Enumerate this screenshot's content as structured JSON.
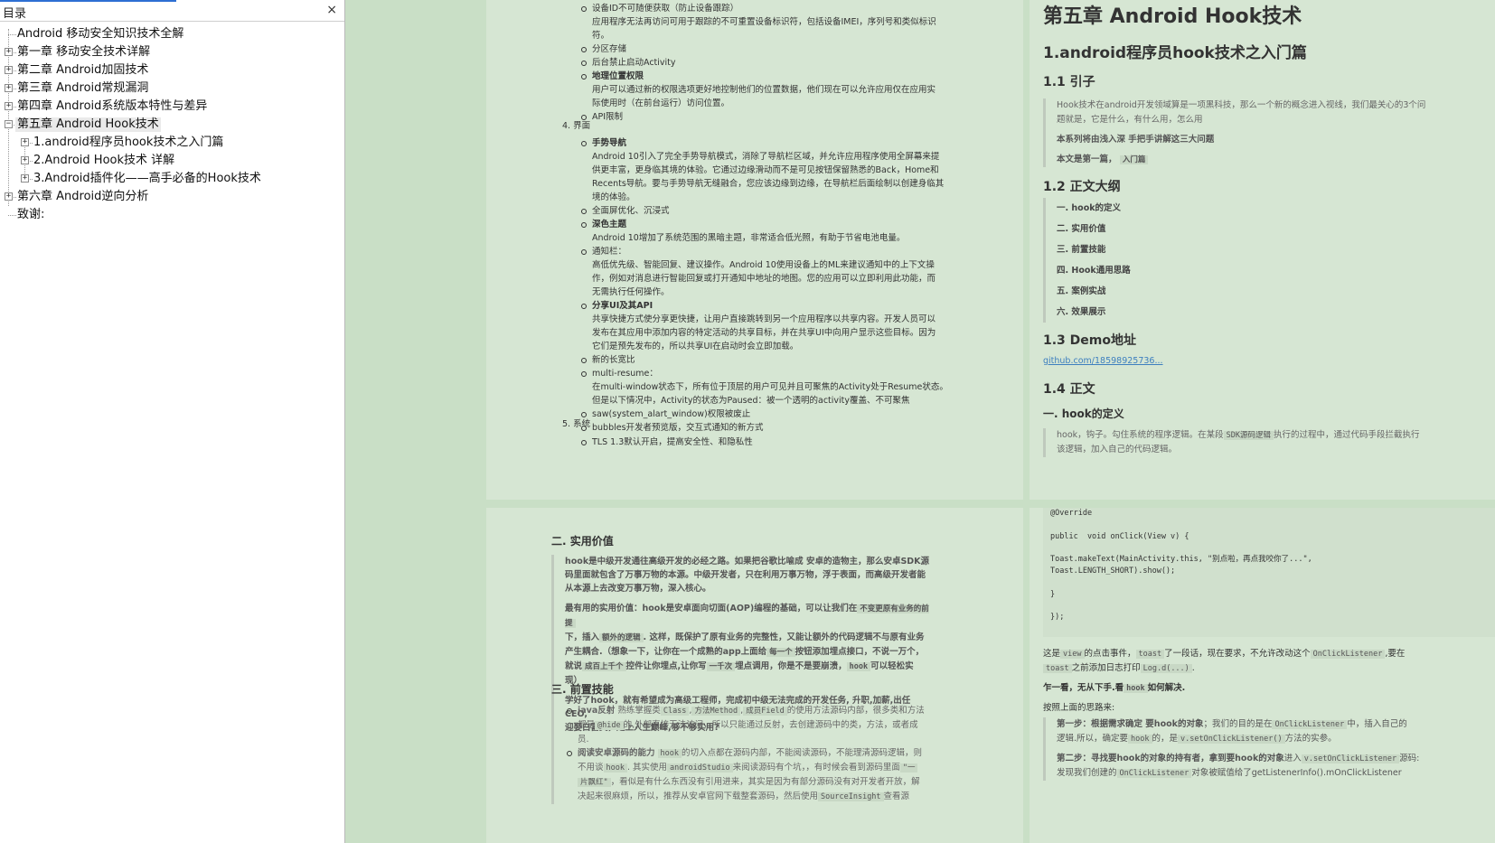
{
  "toc": {
    "title": "目录",
    "close_icon": "×",
    "items": [
      {
        "label": "Android 移动安全知识技术全解"
      },
      {
        "label": "第一章 移动安全技术详解"
      },
      {
        "label": "第二章 Android加固技术"
      },
      {
        "label": "第三章 Android常规漏洞"
      },
      {
        "label": "第四章 Android系统版本特性与差异"
      },
      {
        "label": "第五章 Android Hook技术"
      },
      {
        "label": "1.android程序员hook技术之入门篇"
      },
      {
        "label": "2.Android Hook技术 详解"
      },
      {
        "label": "3.Android插件化——高手必备的Hook技术"
      },
      {
        "label": "第六章 Android逆向分析"
      },
      {
        "label": "致谢:"
      }
    ],
    "expander_plus": "+",
    "expander_minus": "−"
  },
  "page_tl": {
    "items": [
      {
        "title": "设备ID不可随便获取（防止设备跟踪）",
        "bold": false,
        "desc": [
          "应用程序无法再访问可用于跟踪的不可重置设备标识符，包括设备IMEI，序列号和类似标识",
          "符。"
        ]
      },
      {
        "title": "分区存储",
        "bold": false,
        "desc": []
      },
      {
        "title": "后台禁止启动Activity",
        "bold": false,
        "desc": []
      },
      {
        "title": "地理位置权限",
        "bold": true,
        "desc": [
          "用户可以通过新的权限选项更好地控制他们的位置数据，他们现在可以允许应用仅在应用实",
          "际使用时（在前台运行）访问位置。"
        ]
      },
      {
        "title": "API限制",
        "bold": false,
        "desc": []
      }
    ],
    "section4": "4. 界面",
    "section4_items": [
      {
        "title": "手势导航",
        "bold": true,
        "desc": [
          "Android 10引入了完全手势导航模式，消除了导航栏区域，并允许应用程序使用全屏幕来提",
          "供更丰富，更身临其境的体验。它通过边缘滑动而不是可见按钮保留熟悉的Back，Home和",
          "Recents导航。要与手势导航无缝融合，您应该边缘到边缘，在导航栏后面绘制以创建身临其",
          "境的体验。"
        ]
      },
      {
        "title": "全面屏优化、沉浸式",
        "bold": false,
        "desc": []
      },
      {
        "title": "深色主题",
        "bold": true,
        "desc": [
          "Android 10增加了系统范围的黑暗主题，非常适合低光照，有助于节省电池电量。"
        ]
      },
      {
        "title": "通知栏：",
        "bold": false,
        "desc": [
          "高低优先级、智能回复、建议操作。Android 10使用设备上的ML来建议通知中的上下文操",
          "作，例如对消息进行智能回复或打开通知中地址的地图。您的应用可以立即利用此功能，而",
          "无需执行任何操作。"
        ]
      },
      {
        "title": "分享UI及其API",
        "bold": true,
        "desc": [
          "共享快捷方式使分享更快捷，让用户直接跳转到另一个应用程序以共享内容。开发人员可以",
          "发布在其应用中添加内容的特定活动的共享目标，并在共享UI中向用户显示这些目标。因为",
          "它们是预先发布的，所以共享UI在启动时会立即加载。"
        ]
      },
      {
        "title": "新的长宽比",
        "bold": false,
        "desc": []
      },
      {
        "title": "multi-resume：",
        "bold": false,
        "desc": [
          "在multi-window状态下，所有位于顶层的用户可见并且可聚焦的Activity处于Resume状态。",
          "但是以下情况中，Activity的状态为Paused：被一个透明的activity覆盖、不可聚焦"
        ]
      },
      {
        "title": "saw(system_alart_window)权限被废止",
        "bold": false,
        "desc": []
      },
      {
        "title": "bubbles开发者预览版，交互式通知的新方式",
        "bold": false,
        "desc": []
      }
    ],
    "section5": "5. 系统",
    "section5_items": [
      {
        "title": "TLS 1.3默认开启，提高安全性、和隐私性",
        "bold": false,
        "desc": []
      }
    ]
  },
  "page_tr": {
    "h1": "第五章 Android Hook技术",
    "h2": "1.android程序员hook技术之入门篇",
    "s11": "1.1 引子",
    "quote_lines": [
      "Hook技术在android开发领域算是一项黑科技，那么一个新的概念进入视线，我们最关心的3个问",
      "题就是，它是什么，有什么用，怎么用"
    ],
    "series_note": "本系列将由浅入深 手把手讲解这三大问题",
    "article_note": "本文是第一篇，",
    "article_tag": "入门篇",
    "s12": "1.2 正文大纲",
    "outline": [
      "一. hook的定义",
      "二. 实用价值",
      "三. 前置技能",
      "四. Hook通用思路",
      "五. 案例实战",
      "六. 效果展示"
    ],
    "s13": "1.3 Demo地址",
    "demo_link": "github.com/18598925736...",
    "s14": "1.4 正文",
    "s_def": "一. hook的定义",
    "def_part1": "hook，钩子。勾住系统的程序逻辑。在某段",
    "def_code": "SDK源码逻辑",
    "def_part2": "执行的过程中，通过代码手段拦截执行",
    "def_line2": "该逻辑，加入自己的代码逻辑。"
  },
  "page_bl": {
    "h_value": "二. 实用价值",
    "p1_lines": [
      "hook是中级开发通往高级开发的必经之路。如果把谷歌比喻成 安卓的造物主，那么安卓SDK源",
      "码里面就包含了万事万物的本源。中级开发者，只在利用万事万物，浮于表面，而高级开发者能",
      "从本源上去改变万事万物，深入核心。"
    ],
    "p2_a": "最有用的实用价值：hook是安卓面向切面(AOP)编程的基础，可以让我们在",
    "p2_code1": "不变更原有业务的前提",
    "p2_b": "下，插入",
    "p2_code2": "额外的逻辑",
    "p2_c": ". 这样，既保护了原有业务的完整性，又能让额外的代码逻辑不与原有业务",
    "p2_line3": "产生耦合.（想象一下，让你在一个成熟的app上面给",
    "p2_code3": "每一个",
    "p2_line3b": "按钮添加埋点接口，不说一万个，",
    "p2_line4a": "就说",
    "p2_code4": "成百上千个",
    "p2_line4b": "控件让你埋点,让你写",
    "p2_code5": "一千次",
    "p2_line4c": "埋点调用，你是不是要崩溃，",
    "p2_code6": "hook",
    "p2_line4d": "可以轻松实",
    "p2_line5": "现）",
    "p3_lines": [
      "学好了hook，就有希望成为高级工程师，完成初中级无法完成的开发任务, 升职,加薪,出任CEO,",
      "迎娶白富美，走上人生巅峰,够不够实用?"
    ],
    "h_skills": "三. 前置技能",
    "skill1_title": "java反射",
    "skill1_a": "熟练掌握类",
    "skill1_code1": "Class",
    "skill1_b": ",",
    "skill1_code2": "方法Method",
    "skill1_c": ",",
    "skill1_code3": "成员Field",
    "skill1_d": "的使用方法源码内部，很多类和方法",
    "skill1_line2a": "都是",
    "skill1_code4": "@hide",
    "skill1_line2b": "的,外部直接无法访问，所以只能通过反射，去创建源码中的类，方法，或者成",
    "skill1_line3": "员.",
    "skill2_title": "阅读安卓源码的能力",
    "skill2_code1": "hook",
    "skill2_a": "的切入点都在源码内部，不能阅读源码，不能理清源码逻辑，则",
    "skill2_line2a": "不用谈",
    "skill2_code2": "hook",
    "skill2_line2b": ". 其实使用",
    "skill2_code3": "androidStudio",
    "skill2_line2c": "来阅读源码有个坑，，有时候会看到源码里面",
    "skill2_code4": "\"一",
    "skill2_line3a_code": "片飘红\"",
    "skill2_line3b": "，看似是有什么东西没有引用进来，其实是因为有部分源码没有对开发者开放，解",
    "skill2_line4a": "决起来很麻烦，所以，推荐从安卓官网下载整套源码，然后使用",
    "skill2_code5": "SourceInsight",
    "skill2_line4b": "查看源"
  },
  "page_br": {
    "code_lines": [
      "@Override",
      "",
      "public  void onClick(View v) {",
      "",
      "Toast.makeText(MainActivity.this, \"别点啦，再点我咬你了...\",",
      "Toast.LENGTH_SHORT).show();",
      "",
      "}",
      "",
      "});"
    ],
    "p1_a": "这是",
    "p1_code1": "view",
    "p1_b": "的点击事件，",
    "p1_code2": "toast",
    "p1_c": "了一段话，现在要求，不允许改动这个",
    "p1_code3": "OnClickListener",
    "p1_d": ",要在",
    "p1_line2_code1": "toast",
    "p1_line2a": "之前添加日志打印",
    "p1_line2_code2": "Log.d(...)",
    "p1_line2b": ".",
    "p2_a": "乍一看，无从下手.看",
    "p2_code": "hook",
    "p2_b": "如何解决.",
    "p3": "按照上面的思路来:",
    "step1_a": "第一步：根据需求确定 要hook的对象",
    "step1_b": "；我们的目的是在",
    "step1_code1": "OnClickListener",
    "step1_c": "中，插入自己的",
    "step1_line2a": "逻辑.所以，确定要",
    "step1_code2": "hook",
    "step1_line2b": "的，是",
    "step1_code3": "v.setOnClickListener()",
    "step1_line2c": "方法的实参。",
    "step2_a": "第二步：寻找要hook的对象的持有者，拿到要hook的对象",
    "step2_b": "进入",
    "step2_code1": "v.setOnClickListener",
    "step2_c": "源码:",
    "step2_line2a": "发现我们创建的",
    "step2_code2": "OnClickListener",
    "step2_line2b": "对象被赋值给了getListenerInfo().mOnClickListener"
  }
}
